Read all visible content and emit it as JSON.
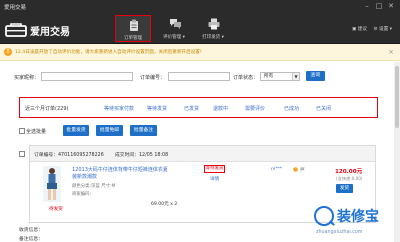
{
  "window": {
    "title": "爱用交易",
    "controls": [
      "minimize",
      "maximize",
      "close"
    ]
  },
  "header": {
    "logo_text": "爱用交易",
    "nav": [
      {
        "label": "订单管理",
        "icon": "clipboard-icon",
        "active": true
      },
      {
        "label": "评价管理 ▾",
        "icon": "chat-bubbles-icon",
        "active": false
      },
      {
        "label": "打印发货 ▾",
        "icon": "printer-icon",
        "active": false
      }
    ],
    "right": {
      "feedback": "▣ 建议",
      "settings": "⚙ 设置 ▾"
    }
  },
  "notice": {
    "text": "12.4日凌晨开放了自动评价功能，请大家重新进入自动评价设置页面，关闭后重新开启设置！"
  },
  "search": {
    "buyer_label": "买家昵称：",
    "buyer_value": "",
    "order_label": "订单编号：",
    "order_value": "",
    "status_label": "订单状态：",
    "status_value": "所有",
    "query_button": "查询"
  },
  "tabs": [
    "近三个月订单(229)",
    "等待买家付款",
    "等待发货",
    "已发货",
    "退款中",
    "需要评价",
    "已成功",
    "已关闭"
  ],
  "batch": {
    "select_all_label": "全选",
    "batch_ship_partial": "批量",
    "buttons": [
      "批量发货",
      "批量免邮",
      "批量备注"
    ]
  },
  "order": {
    "order_id_label": "订单编号：470116095278226",
    "created_label": "成交时间：12/05 18:08",
    "product_title": "12013大码牛仔连体背带牛仔短裤连体衣夏装新款潮款",
    "product_meta_1": "颜色分类:深蓝 尺寸:M",
    "product_meta_2": "商家编码：",
    "product_price": "69.00元 x 2",
    "eval_tag": "待发货",
    "status_badge": "等待发货",
    "detail_link": "详情",
    "buyer_name": "ni***",
    "total": "120.00元",
    "shipping": "(含快递:0.00)",
    "ship_button": "发货"
  },
  "footer_rows": [
    "收货信息：",
    "备注信息："
  ],
  "watermark": {
    "brand": "装修宝",
    "url": "zhuangxiuzhai.com"
  }
}
